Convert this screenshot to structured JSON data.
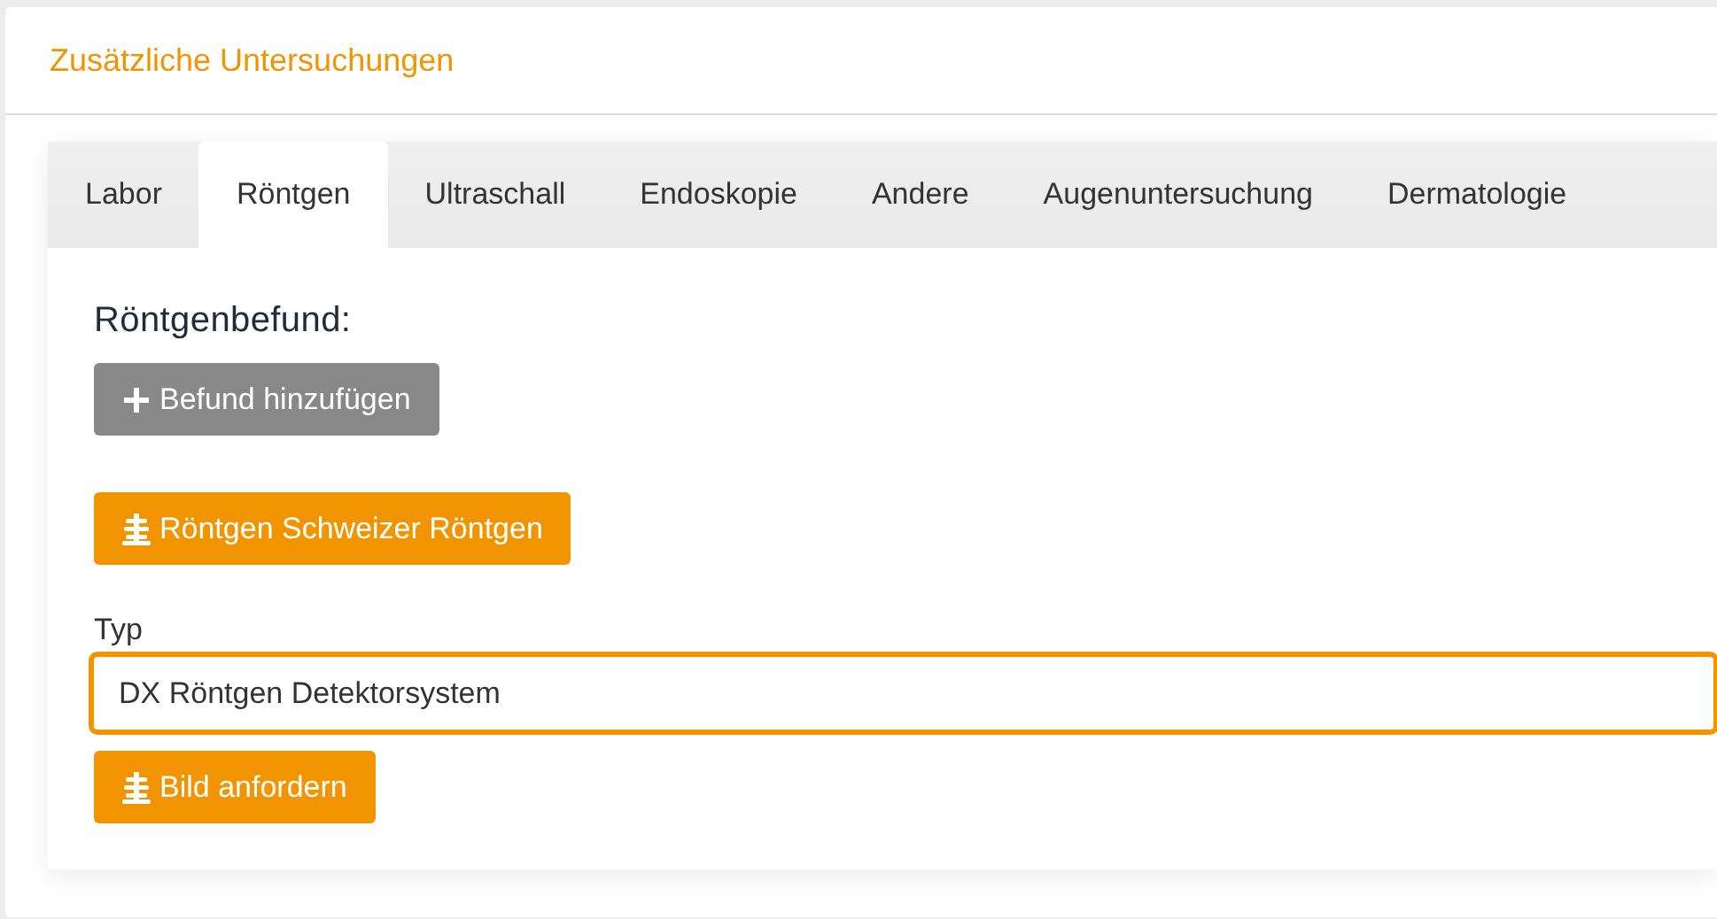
{
  "card": {
    "title": "Zusätzliche Untersuchungen"
  },
  "tabs": [
    {
      "label": "Labor",
      "selected": false
    },
    {
      "label": "Röntgen",
      "selected": true
    },
    {
      "label": "Ultraschall",
      "selected": false
    },
    {
      "label": "Endoskopie",
      "selected": false
    },
    {
      "label": "Andere",
      "selected": false
    },
    {
      "label": "Augenuntersuchung",
      "selected": false
    },
    {
      "label": "Dermatologie",
      "selected": false
    }
  ],
  "section_title": "Röntgenbefund:",
  "add_button": {
    "kind": "add",
    "label": "Befund hinzufügen"
  },
  "order_button": {
    "kind": "xray",
    "label": "Röntgen Schweizer Röntgen"
  },
  "type_field": {
    "label": "Typ",
    "value": "DX Röntgen Detektorsystem",
    "focused": true
  },
  "image_button": {
    "kind": "xray",
    "label": "Bild anfordern"
  }
}
